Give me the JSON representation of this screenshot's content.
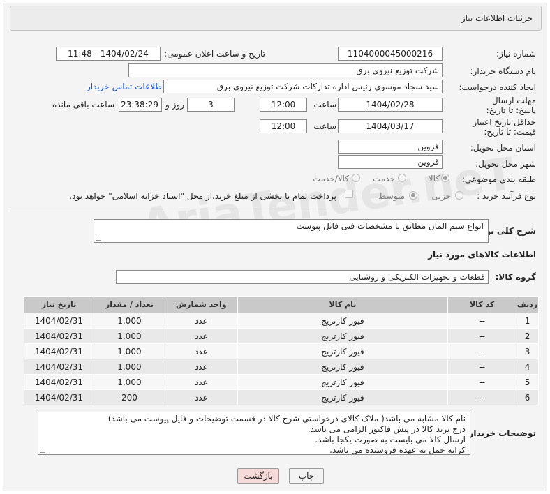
{
  "header": {
    "title": "جزئیات اطلاعات نیاز"
  },
  "fields": {
    "need_number_label": "شماره نیاز:",
    "need_number": "1104000045000216",
    "announce_label": "تاریخ و ساعت اعلان عمومی:",
    "announce_value": "1404/02/24 - 11:48",
    "buyer_org_label": "نام دستگاه خریدار:",
    "buyer_org": "شرکت توزیع نیروی برق",
    "requester_label": "ایجاد کننده درخواست:",
    "requester": "سید سجاد موسوی رئیس اداره تدارکات شرکت توزیع نیروی برق",
    "contact_link": "اطلاعات تماس خریدار",
    "reply_deadline_label": "مهلت ارسال پاسخ: تا تاریخ:",
    "reply_date": "1404/02/28",
    "time_label": "ساعت",
    "reply_time": "12:00",
    "days_value": "3",
    "days_label": "روز و",
    "remaining_time": "23:38:29",
    "remaining_label": "ساعت باقی مانده",
    "price_validity_label": "حداقل تاریخ اعتبار قیمت: تا تاریخ:",
    "validity_date": "1404/03/17",
    "validity_time": "12:00",
    "province_label": "استان محل تحویل:",
    "province": "قزوین",
    "city_label": "شهر محل تحویل:",
    "city": "قزوین",
    "category_label": "طبقه بندی موضوعی:",
    "category_options": [
      "کالا",
      "خدمت",
      "کالا/خدمت"
    ],
    "process_label": "نوع فرآیند خرید :",
    "process_options": [
      "جزیی",
      "متوسط"
    ],
    "payment_note": "پرداخت تمام یا بخشی از مبلغ خرید،از محل \"اسناد خزانه اسلامی\" خواهد بود."
  },
  "description": {
    "label": "شرح کلی نیاز:",
    "value": "انواع سیم المان مطابق با مشخصات فنی فایل پیوست"
  },
  "goods_section": {
    "title": "اطلاعات کالاهای مورد نیاز",
    "group_label": "گروه کالا:",
    "group_value": "قطعات و تجهیزات الکتریکی و روشنایی"
  },
  "table": {
    "headers": [
      "ردیف",
      "کد کالا",
      "نام کالا",
      "واحد شمارش",
      "تعداد / مقدار",
      "تاریخ نیاز"
    ],
    "rows": [
      [
        "1",
        "--",
        "فیوز کارتریج",
        "عدد",
        "1,000",
        "1404/02/31"
      ],
      [
        "2",
        "--",
        "فیوز کارتریج",
        "عدد",
        "1,000",
        "1404/02/31"
      ],
      [
        "3",
        "--",
        "فیوز کارتریج",
        "عدد",
        "1,000",
        "1404/02/31"
      ],
      [
        "4",
        "--",
        "فیوز کارتریج",
        "عدد",
        "1,000",
        "1404/02/31"
      ],
      [
        "5",
        "--",
        "فیوز کارتریج",
        "عدد",
        "1,000",
        "1404/02/31"
      ],
      [
        "6",
        "--",
        "فیوز کارتریج",
        "عدد",
        "200",
        "1404/02/31"
      ]
    ]
  },
  "buyer_notes": {
    "label": "توضیحات خریدار:",
    "lines": [
      "نام کالا مشابه می باشد( ملاک کالای درخواستی شرح کالا در قسمت توضیحات و فایل پیوست می باشد)",
      "درج برند کالا در پیش فاکتور الزامی می باشد.",
      "ارسال کالا می بایست به صورت یکجا باشد.",
      "کرایه حمل به عهده فروشنده می باشد."
    ]
  },
  "buttons": {
    "print": "چاپ",
    "back": "بازگشت"
  },
  "colors": {
    "link": "#1a56c8",
    "back_button_bg": "#f6d9d9",
    "table_header_bg": "#c9c9c9"
  }
}
